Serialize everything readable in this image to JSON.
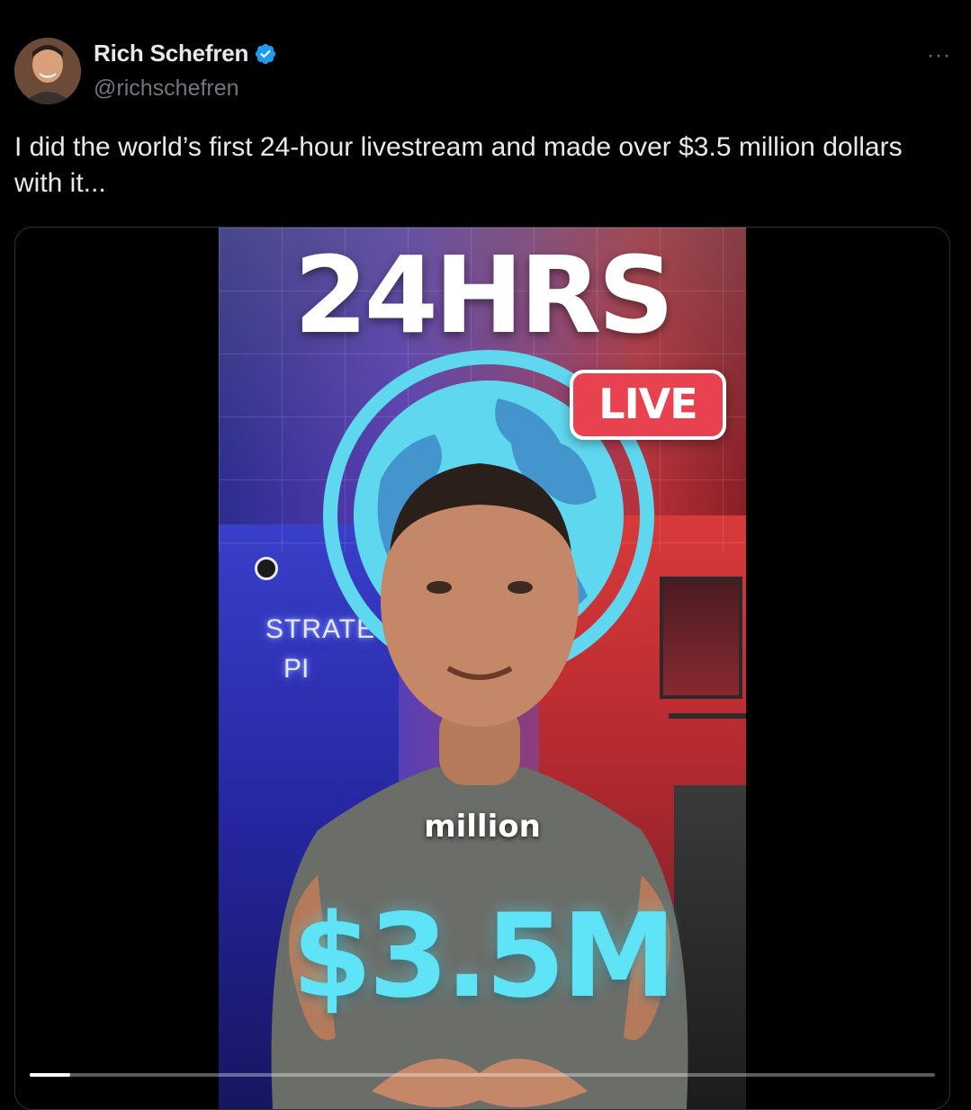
{
  "author": {
    "display_name": "Rich Schefren",
    "handle": "@richschefren",
    "verified": true,
    "verified_color": "#1d9bf0",
    "avatar_icon": "profile-photo"
  },
  "more_menu": {
    "icon": "more-horizontal-icon",
    "glyph": "···"
  },
  "tweet": {
    "text": "I did the world’s first 24-hour livestream and made over $3.5 million dollars with it..."
  },
  "media": {
    "type": "video",
    "overlay_title": "24HRS",
    "live_badge": "LIVE",
    "neon_sign_line1": "STRATE",
    "neon_sign_line2": "PI",
    "caption": "million",
    "amount": "$3.5M",
    "progress": 0.045,
    "colors": {
      "amount": "#5fe3f7",
      "globe": "#5fd8ef",
      "live_badge": "#e8414f"
    }
  }
}
